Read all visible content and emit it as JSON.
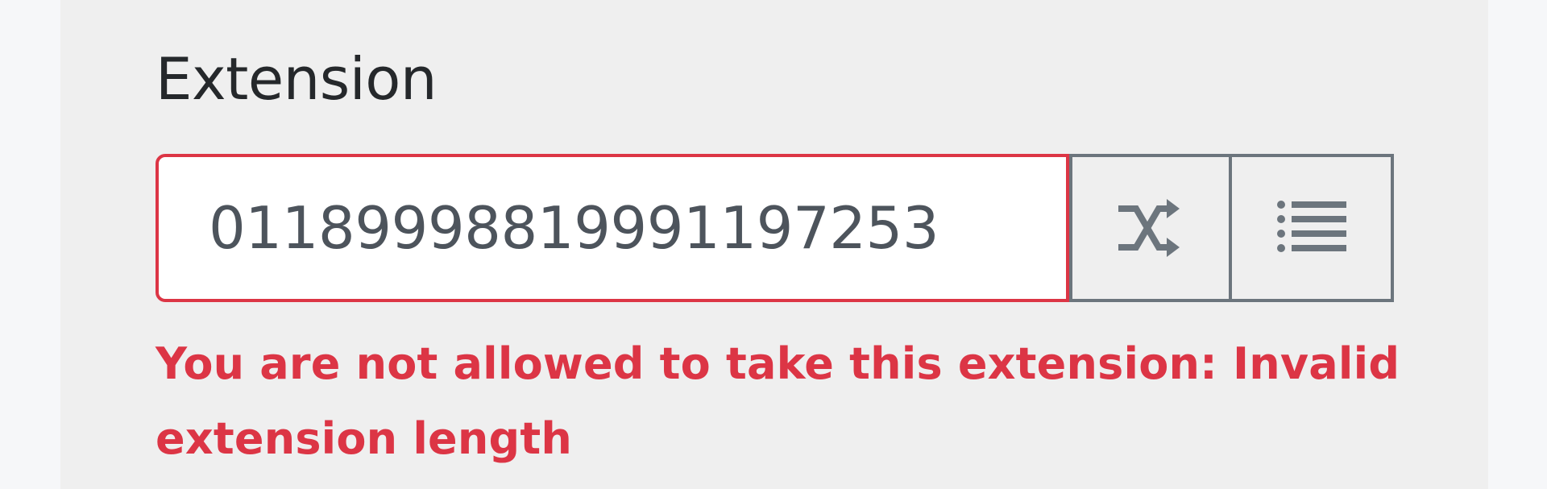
{
  "field": {
    "label": "Extension",
    "value": "01189998819991197253",
    "error": "You are not allowed to take this extension: Invalid extension length"
  },
  "icons": {
    "randomize": "shuffle-icon",
    "list": "list-icon"
  },
  "colors": {
    "error": "#dc3545",
    "addon_border": "#6c757d",
    "input_text": "#4d545c"
  }
}
